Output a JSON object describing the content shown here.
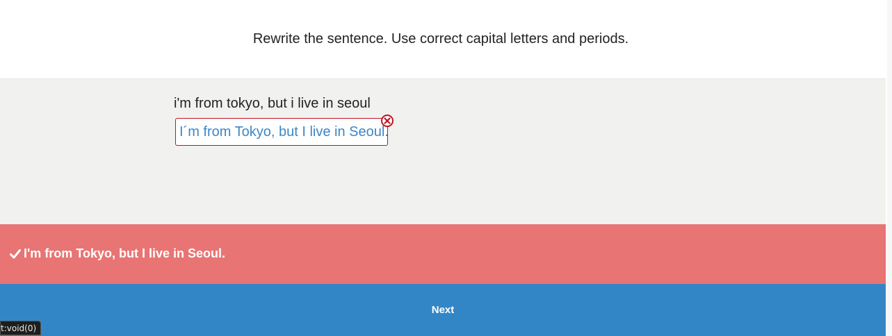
{
  "instruction": "Rewrite the sentence. Use correct capital letters and periods.",
  "exercise": {
    "prompt": "i'm from tokyo, but i live in seoul",
    "user_answer": "I´m from Tokyo, but I live in Seoul.",
    "answer_status": "incorrect",
    "error_icon": "close-circle-icon"
  },
  "feedback": {
    "icon": "checkmark-icon",
    "correct_answer": "I'm from Tokyo, but I live in Seoul."
  },
  "next_button": {
    "label": "Next"
  },
  "status_bar": {
    "link_text": "t:void(0)"
  },
  "colors": {
    "error_red": "#c1121f",
    "answer_blue": "#3d86c6",
    "feedback_bg": "#e97474",
    "button_blue": "#3386c6",
    "work_area_bg": "#f1f1ef"
  }
}
